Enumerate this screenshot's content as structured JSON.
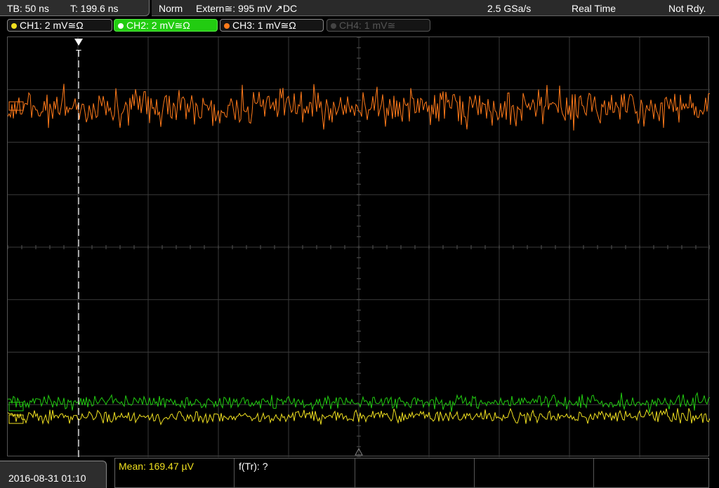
{
  "topbar": {
    "timebase": "TB: 50 ns",
    "trigger_time": "T: 199.6 ns",
    "mode": "Norm",
    "trigger_source": "Extern≅: 995 mV ↗DC",
    "sample_rate": "2.5 GSa/s",
    "acq_mode": "Real Time",
    "status": "Not Rdy."
  },
  "channels": [
    {
      "label": "CH1: 2 mV≅Ω",
      "color": "#f0e020"
    },
    {
      "label": "CH2: 2 mV≅Ω",
      "color": "#22cc11"
    },
    {
      "label": "CH3: 1 mV≅Ω",
      "color": "#ff7a1a"
    },
    {
      "label": "CH4: 1 mV≅",
      "color": "#555555"
    }
  ],
  "trigger_marker": "T",
  "bottom": {
    "datetime": "2016-08-31 01:10",
    "mean": "Mean: 169.47 µV",
    "freq": "f(Tr): ?"
  },
  "colors": {
    "ch1": "#f0e020",
    "ch2": "#22cc11",
    "ch3": "#ff7a1a",
    "meas_text": "#f0e020",
    "grid": "#3a3a3a"
  }
}
